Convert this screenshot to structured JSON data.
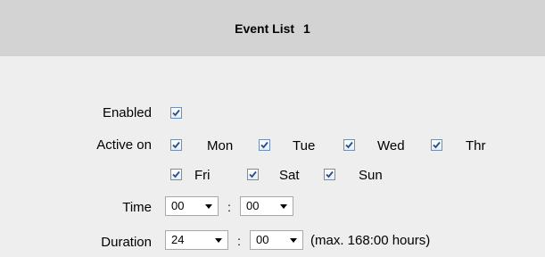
{
  "header": {
    "title": "Event List",
    "number": "1"
  },
  "form": {
    "enabled_label": "Enabled",
    "active_label": "Active on",
    "days": [
      "Mon",
      "Tue",
      "Wed",
      "Thr",
      "Fri",
      "Sat",
      "Sun"
    ],
    "time_label": "Time",
    "time_hour": "00",
    "time_minute": "00",
    "duration_label": "Duration",
    "duration_hour": "24",
    "duration_minute": "00",
    "separator": ":",
    "duration_note": "(max. 168:00 hours)"
  },
  "colors": {
    "header_bg": "#d3d3d3",
    "panel_bg": "#eeeeee",
    "checkbox_border": "#6f8fb5"
  }
}
